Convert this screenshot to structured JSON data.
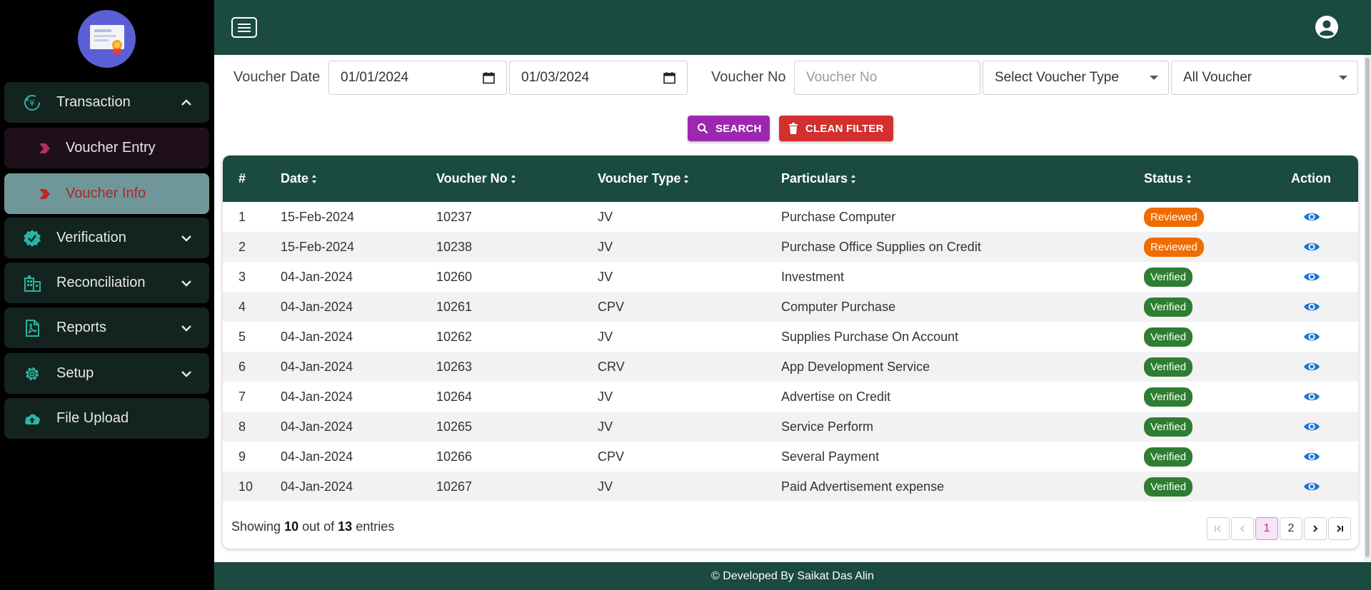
{
  "sidebar": {
    "items": [
      {
        "label": "Transaction",
        "icon": "yen-cycle-icon"
      },
      {
        "label": "Verification",
        "icon": "verified-badge-icon"
      },
      {
        "label": "Reconciliation",
        "icon": "building-icon"
      },
      {
        "label": "Reports",
        "icon": "pdf-file-icon"
      },
      {
        "label": "Setup",
        "icon": "gear-icon"
      },
      {
        "label": "File Upload",
        "icon": "cloud-upload-icon"
      }
    ],
    "subitems": [
      {
        "label": "Voucher Entry"
      },
      {
        "label": "Voucher Info"
      }
    ]
  },
  "filters": {
    "date_label": "Voucher Date",
    "date_from": "01/01/2024",
    "date_to": "01/03/2024",
    "voucher_no_label": "Voucher No",
    "voucher_no_placeholder": "Voucher No",
    "voucher_type_select": "Select Voucher Type",
    "voucher_status_select": "All Voucher",
    "search_label": "SEARCH",
    "clean_label": "CLEAN FILTER"
  },
  "table": {
    "headers": [
      "#",
      "Date",
      "Voucher No",
      "Voucher Type",
      "Particulars",
      "Status",
      "Action"
    ],
    "rows": [
      {
        "n": "1",
        "date": "15-Feb-2024",
        "no": "10237",
        "type": "JV",
        "particulars": "Purchase Computer",
        "status": "Reviewed"
      },
      {
        "n": "2",
        "date": "15-Feb-2024",
        "no": "10238",
        "type": "JV",
        "particulars": "Purchase Office Supplies on Credit",
        "status": "Reviewed"
      },
      {
        "n": "3",
        "date": "04-Jan-2024",
        "no": "10260",
        "type": "JV",
        "particulars": "Investment",
        "status": "Verified"
      },
      {
        "n": "4",
        "date": "04-Jan-2024",
        "no": "10261",
        "type": "CPV",
        "particulars": "Computer Purchase",
        "status": "Verified"
      },
      {
        "n": "5",
        "date": "04-Jan-2024",
        "no": "10262",
        "type": "JV",
        "particulars": "Supplies Purchase On Account",
        "status": "Verified"
      },
      {
        "n": "6",
        "date": "04-Jan-2024",
        "no": "10263",
        "type": "CRV",
        "particulars": "App Development Service",
        "status": "Verified"
      },
      {
        "n": "7",
        "date": "04-Jan-2024",
        "no": "10264",
        "type": "JV",
        "particulars": "Advertise on Credit",
        "status": "Verified"
      },
      {
        "n": "8",
        "date": "04-Jan-2024",
        "no": "10265",
        "type": "JV",
        "particulars": "Service Perform",
        "status": "Verified"
      },
      {
        "n": "9",
        "date": "04-Jan-2024",
        "no": "10266",
        "type": "CPV",
        "particulars": "Several Payment",
        "status": "Verified"
      },
      {
        "n": "10",
        "date": "04-Jan-2024",
        "no": "10267",
        "type": "JV",
        "particulars": "Paid Advertisement expense",
        "status": "Verified"
      }
    ]
  },
  "pagination": {
    "showing_prefix": "Showing",
    "shown": "10",
    "out_of": "out of",
    "total": "13",
    "entries": "entries",
    "pages": [
      "1",
      "2"
    ]
  },
  "footer": {
    "text": "© Developed By Saikat Das Alin"
  },
  "colors": {
    "primary": "#1a4a40",
    "reviewed": "#ef6c00",
    "verified": "#2e7d32",
    "search_button": "#9c27b0",
    "clean_button": "#d32f2f",
    "active_sub_bg": "#6f9799",
    "active_sub_text": "#b0262b",
    "inactive_sub_bg": "#1e0f19",
    "eye": "#1976d2"
  }
}
